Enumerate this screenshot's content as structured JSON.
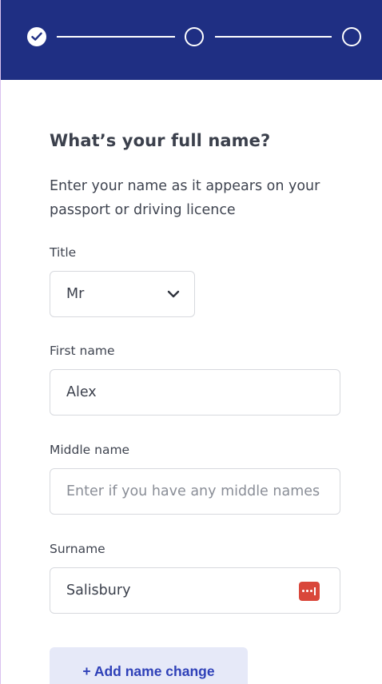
{
  "colors": {
    "header_background": "#1f2f83",
    "primary_text": "#3b404c",
    "button_background": "#e6e9f8",
    "button_text": "#2e40b8",
    "password_badge": "#d9473b"
  },
  "progress": {
    "steps": [
      {
        "status": "completed",
        "icon": "checkmark-icon"
      },
      {
        "status": "pending",
        "icon": "empty-circle-icon"
      },
      {
        "status": "pending",
        "icon": "empty-circle-icon"
      }
    ]
  },
  "form": {
    "heading": "What’s your full name?",
    "intro": "Enter your name as it appears on your passport or driving licence",
    "title": {
      "label": "Title",
      "value": "Mr",
      "icon": "chevron-down-icon"
    },
    "first_name": {
      "label": "First name",
      "value": "Alex"
    },
    "middle_name": {
      "label": "Middle name",
      "placeholder": "Enter if you have any middle names"
    },
    "surname": {
      "label": "Surname",
      "value": "Salisbury",
      "icon": "password-manager-icon"
    },
    "add_name_change_label": "+ Add name change"
  }
}
